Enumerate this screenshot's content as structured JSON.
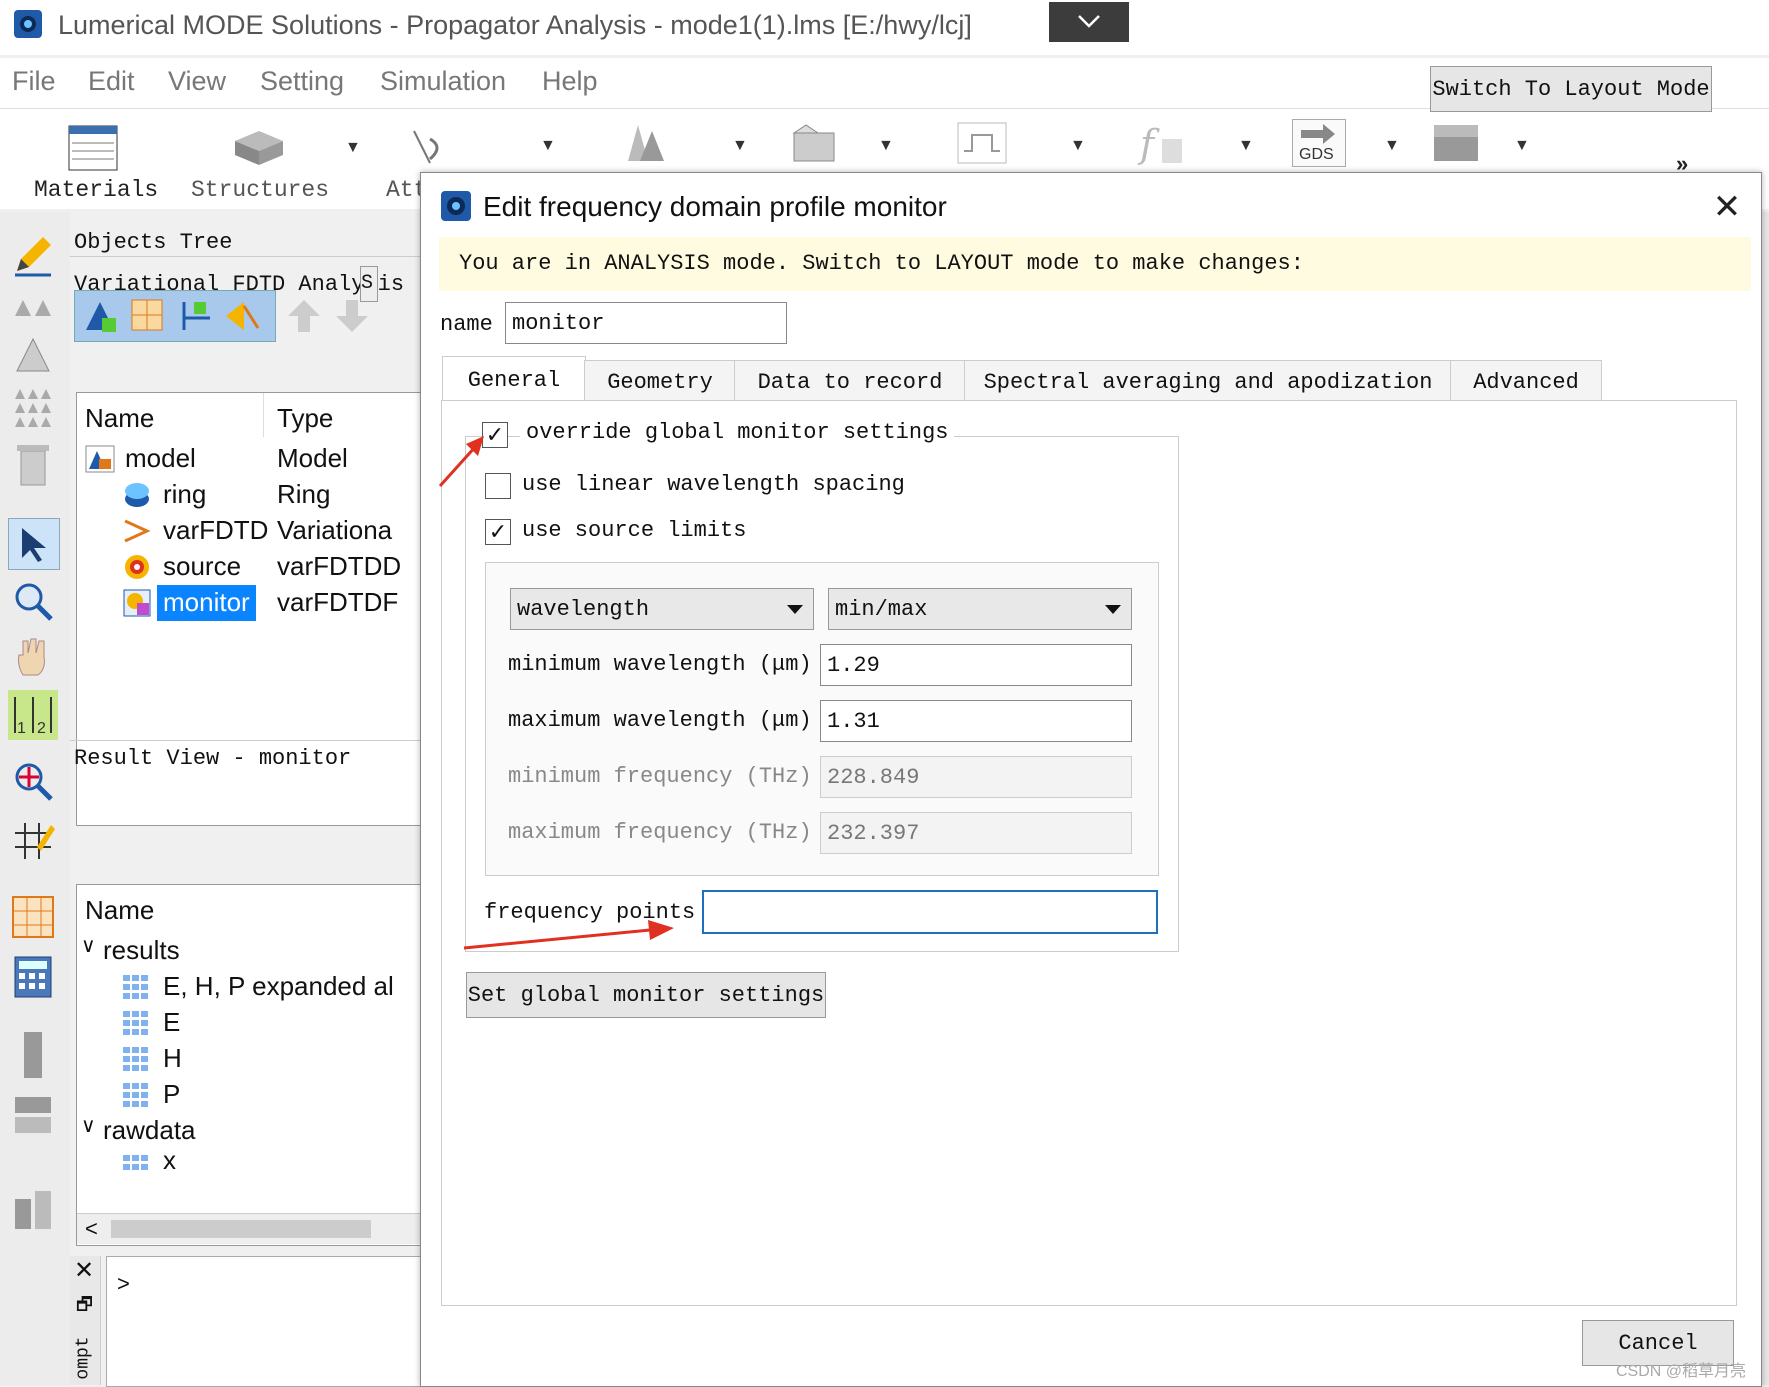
{
  "app": {
    "title": "Lumerical MODE Solutions - Propagator Analysis - mode1(1).lms [E:/hwy/lcj]"
  },
  "menu": [
    "File",
    "Edit",
    "View",
    "Setting",
    "Simulation",
    "Help"
  ],
  "toolbar": {
    "materials": "Materials",
    "structures": "Structures",
    "attributes": "Att",
    "gds": "GDS",
    "more": "»"
  },
  "objects": {
    "header": "Objects Tree",
    "analysis": "Variational FDTD Analysis",
    "analysis_tab": "S",
    "columns": {
      "name": "Name",
      "type": "Type"
    },
    "rows": [
      {
        "name": "model",
        "type": "Model"
      },
      {
        "name": "ring",
        "type": "Ring"
      },
      {
        "name": "varFDTD",
        "type": "Variationa"
      },
      {
        "name": "source",
        "type": "varFDTDD"
      },
      {
        "name": "monitor",
        "type": "varFDTDF"
      }
    ]
  },
  "results": {
    "header": "Result View - monitor",
    "column": "Name",
    "groups": [
      {
        "name": "results",
        "items": [
          "E, H, P expanded al",
          "E",
          "H",
          "P"
        ]
      },
      {
        "name": "rawdata",
        "items": [
          "x"
        ]
      }
    ]
  },
  "prompt": {
    "label": "ompt",
    "arrow": ">"
  },
  "dialog": {
    "title": "Edit frequency domain profile monitor",
    "notice": "You are in ANALYSIS mode.  Switch to LAYOUT mode to make changes:",
    "switch_button": "Switch To Layout Mode",
    "name_label": "name",
    "name_value": "monitor",
    "tabs": [
      "General",
      "Geometry",
      "Data to record",
      "Spectral averaging and apodization",
      "Advanced"
    ],
    "override_label": "override global monitor settings",
    "override_checked": true,
    "linear_label": "use linear wavelength spacing",
    "linear_checked": false,
    "source_limits_label": "use source limits",
    "source_limits_checked": true,
    "select_quantity": "wavelength",
    "select_range": "min/max",
    "min_wl_label": "minimum wavelength (μm)",
    "min_wl_value": "1.29",
    "max_wl_label": "maximum wavelength (μm)",
    "max_wl_value": "1.31",
    "min_f_label": "minimum frequency (THz)",
    "min_f_value": "228.849",
    "max_f_label": "maximum frequency (THz)",
    "max_f_value": "232.397",
    "freq_points_label": "frequency points",
    "freq_points_value": "",
    "global_button": "Set global monitor settings",
    "cancel_button": "Cancel"
  },
  "watermark": "CSDN @稻草月亮",
  "colors": {
    "selection": "#0a84ff",
    "arrow": "#e03020",
    "accent": "#1e5aa8"
  }
}
